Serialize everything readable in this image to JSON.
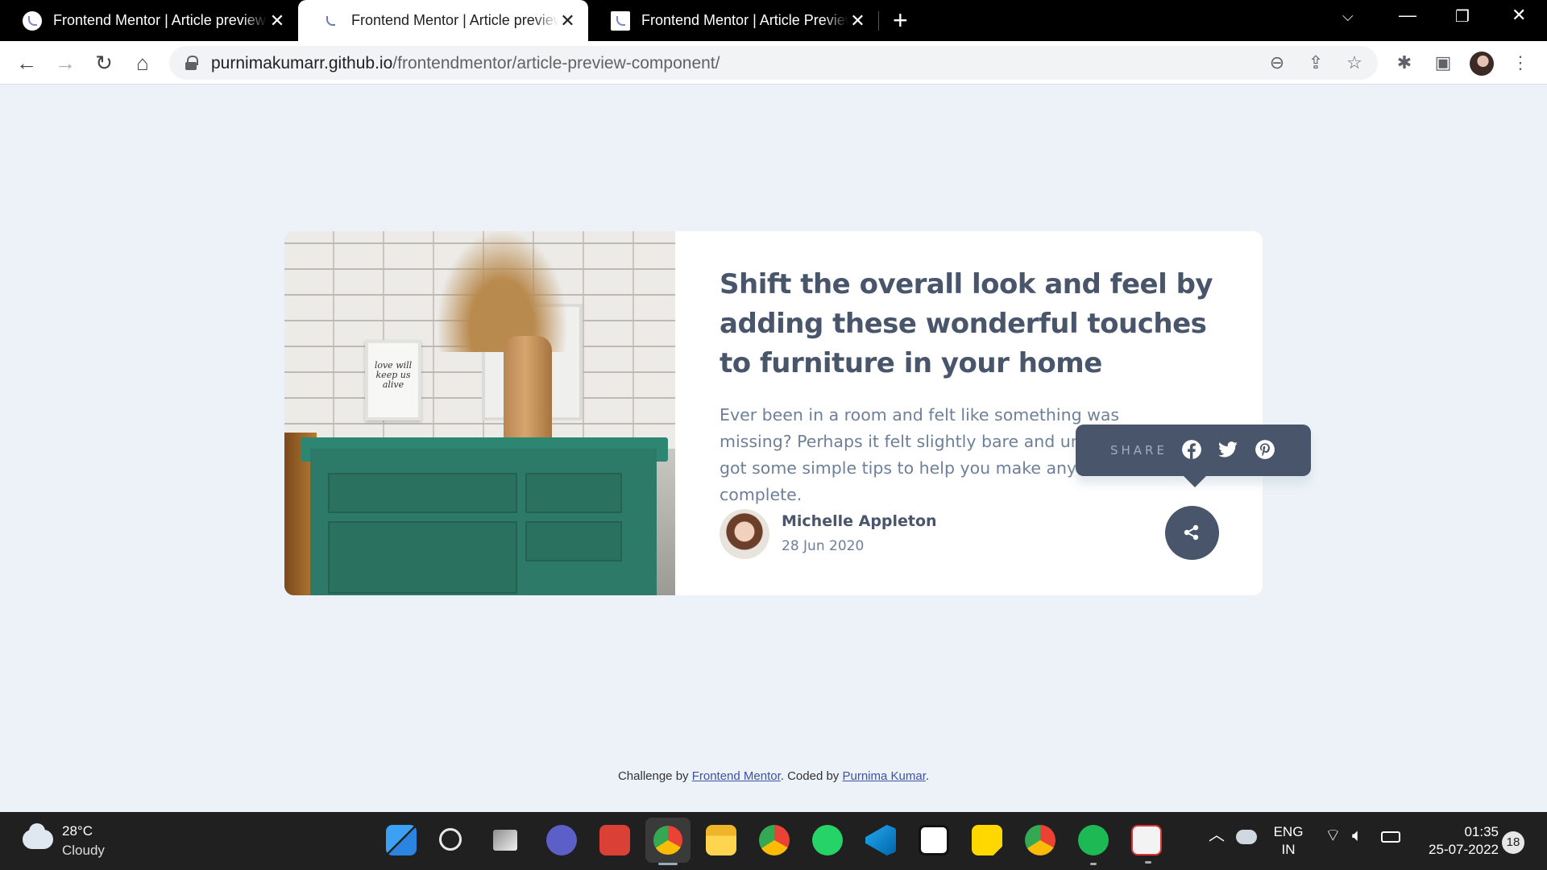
{
  "browser": {
    "tabs": [
      {
        "title": "Frontend Mentor | Article preview",
        "active": false
      },
      {
        "title": "Frontend Mentor | Article preview",
        "active": true
      },
      {
        "title": "Frontend Mentor | Article Preview",
        "active": false
      }
    ],
    "url_host": "purnimakumarr.github.io",
    "url_path": "/frontendmentor/article-preview-component/"
  },
  "article": {
    "headline": "Shift the overall look and feel by adding these wonderful touches to furniture in your home",
    "excerpt": "Ever been in a room and felt like something was missing? Perhaps it felt slightly bare and uninviting. I’ve got some simple tips to help you make any room feel complete.",
    "author_name": "Michelle Appleton",
    "date": "28 Jun 2020",
    "frame_text": "love will keep us alive"
  },
  "share_popup": {
    "label": "SHARE",
    "icons": [
      "facebook-icon",
      "twitter-icon",
      "pinterest-icon"
    ]
  },
  "footer": {
    "prefix": "Challenge by ",
    "challenge_link": "Frontend Mentor",
    "middle": ". Coded by ",
    "coder_link": "Purnima Kumar",
    "suffix": "."
  },
  "taskbar": {
    "temperature": "28°C",
    "condition": "Cloudy",
    "language_top": "ENG",
    "language_bottom": "IN",
    "time": "01:35",
    "date": "25-07-2022",
    "notifications": "18"
  },
  "colors": {
    "page_bg": "#ecf2f8",
    "dark_blue": "#48556a",
    "grayish_blue": "#6e8098",
    "light_grayish_blue": "#9eafc2"
  }
}
